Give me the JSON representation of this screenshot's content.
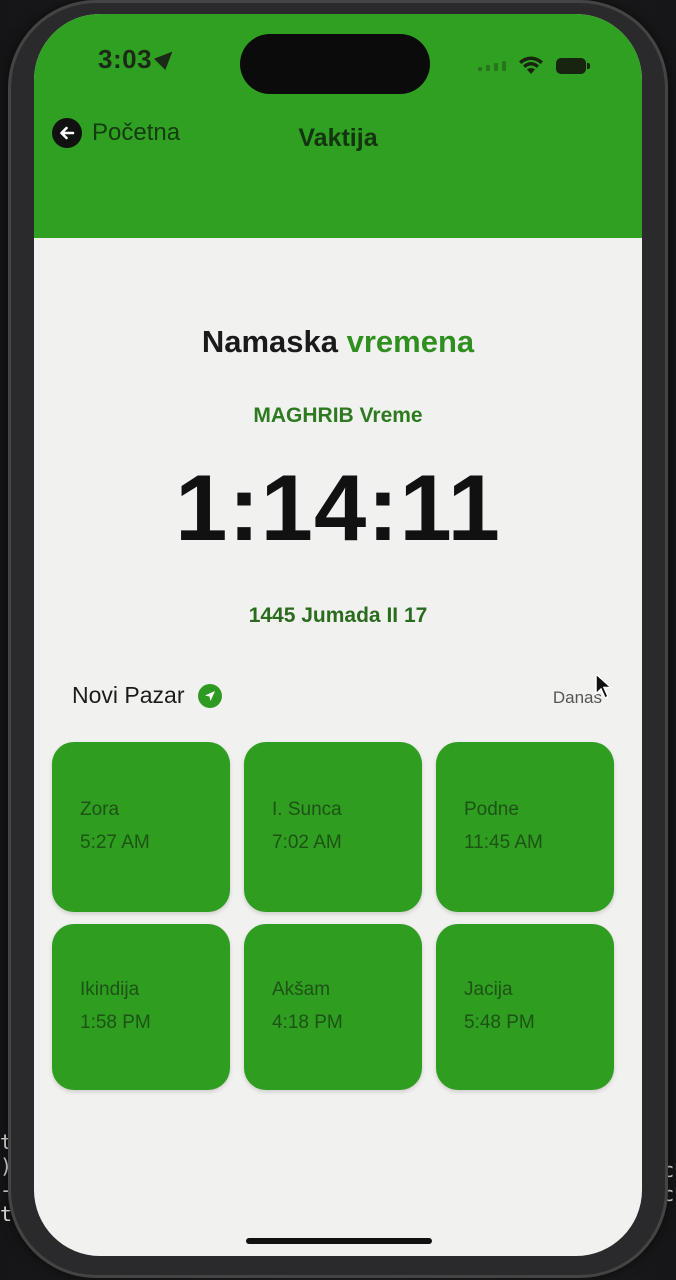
{
  "status_bar": {
    "time": "3:03"
  },
  "nav": {
    "back_label": "Početna",
    "title": "Vaktija"
  },
  "main": {
    "title_part1": "Namaska",
    "title_part2": "vremena",
    "current_prayer": "MAGHRIB Vreme",
    "countdown": "1:14:11",
    "hijri_date": "1445 Jumada II 17",
    "city": "Novi Pazar",
    "date_label": "Danas"
  },
  "prayer_times": [
    {
      "name": "Zora",
      "time": "5:27 AM"
    },
    {
      "name": "I. Sunca",
      "time": "7:02 AM"
    },
    {
      "name": "Podne",
      "time": "11:45 AM"
    },
    {
      "name": "Ikindija",
      "time": "1:58 PM"
    },
    {
      "name": "Akšam",
      "time": "4:18 PM"
    },
    {
      "name": "Jacija",
      "time": "5:48 PM"
    }
  ],
  "terminal": {
    "left_lines": [
      "t f",
      ") fi",
      "-loc",
      "tific"
    ],
    "right_lines": [
      "od c",
      "nd c"
    ]
  },
  "colors": {
    "accent_green": "#2fa022",
    "tile_green": "#2e9d20",
    "screen_background": "#f1f1ef"
  }
}
